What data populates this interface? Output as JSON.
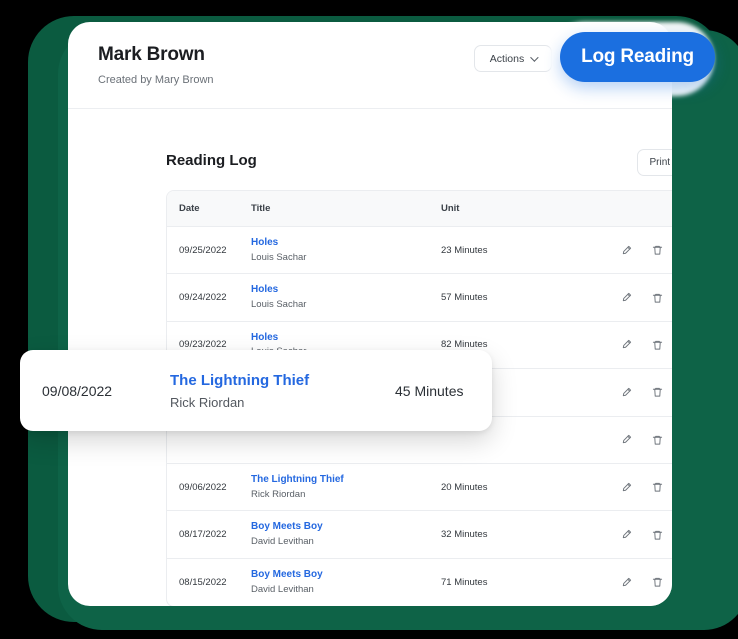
{
  "header": {
    "title": "Mark Brown",
    "subtitle": "Created by Mary Brown",
    "actions_label": "Actions",
    "log_reading_label": "Log Reading",
    "chevron_icon": "chevron-down-icon"
  },
  "section": {
    "title": "Reading Log",
    "print_label": "Print Log"
  },
  "table": {
    "columns": [
      "Date",
      "Title",
      "Unit"
    ],
    "rows": [
      {
        "date": "09/25/2022",
        "title": "Holes",
        "author": "Louis Sachar",
        "unit": "23 Minutes"
      },
      {
        "date": "09/24/2022",
        "title": "Holes",
        "author": "Louis Sachar",
        "unit": "57 Minutes"
      },
      {
        "date": "09/23/2022",
        "title": "Holes",
        "author": "Louis Sachar",
        "unit": "82 Minutes"
      },
      {
        "date": "",
        "title": "",
        "author": "",
        "unit": ""
      },
      {
        "date": "",
        "title": "",
        "author": "",
        "unit": ""
      },
      {
        "date": "09/06/2022",
        "title": "The Lightning Thief",
        "author": "Rick Riordan",
        "unit": "20 Minutes"
      },
      {
        "date": "08/17/2022",
        "title": "Boy Meets Boy",
        "author": "David Levithan",
        "unit": "32 Minutes"
      },
      {
        "date": "08/15/2022",
        "title": "Boy Meets Boy",
        "author": "David Levithan",
        "unit": "71 Minutes"
      }
    ],
    "edit_icon": "pencil-icon",
    "delete_icon": "trash-icon"
  },
  "highlighted_row": {
    "date": "09/08/2022",
    "title": "The Lightning Thief",
    "author": "Rick Riordan",
    "unit": "45 Minutes"
  },
  "colors": {
    "frame_green": "#0b5b40",
    "primary_blue": "#1b6fe0",
    "link_blue": "#2468e0",
    "background": "#000000"
  }
}
